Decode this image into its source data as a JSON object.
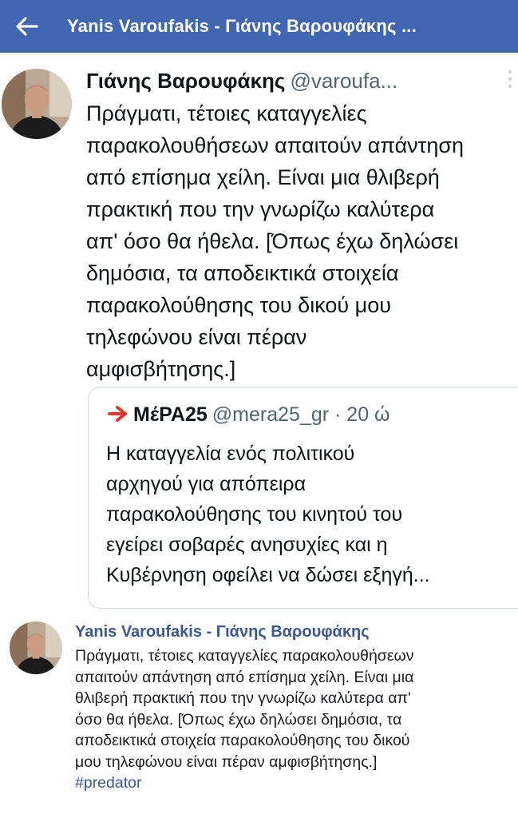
{
  "topbar": {
    "back_icon": "arrow-left-icon",
    "title": "Yanis Varoufakis - Γιάνης Βαρουφάκης ...",
    "bg_color": "#4267b2"
  },
  "tweet": {
    "name": "Γιάνης Βαρουφάκης",
    "handle": "@varoufa...",
    "lines": [
      "Πράγματι, τέτοιες καταγγελίες",
      "παρακολουθήσεων απαιτούν απάντηση",
      "από επίσημα χείλη. Είναι μια θλιβερή",
      "πρακτική που την γνωρίζω καλύτερα",
      "απ' όσο θα ήθελα. [Όπως έχω δηλώσει",
      "δημόσια, τα αποδεικτικά στοιχεία",
      "παρακολούθησης του δικού μου",
      "τηλεφώνου  είναι πέραν",
      "αμφισβήτησης.]"
    ],
    "quote": {
      "name": "ΜέΡΑ25",
      "meta": "@mera25_gr · 20 ώ",
      "lines": [
        "Η καταγγελία ενός πολιτικού",
        "αρχηγού για απόπειρα",
        "παρακολούθησης του κινητού του",
        "εγείρει σοβαρές ανησυχίες και η",
        "Κυβέρνηση οφείλει να δώσει εξηγή..."
      ]
    }
  },
  "post": {
    "author": "Yanis Varoufakis - Γιάνης Βαρουφάκης",
    "lines": [
      "Πράγματι, τέτοιες καταγγελίες παρακολουθήσεων",
      "απαιτούν απάντηση από επίσημα χείλη. Είναι μια",
      "θλιβερή πρακτική που την γνωρίζω καλύτερα απ'",
      "όσο θα ήθελα. [Όπως έχω δηλώσει δημόσια, τα",
      "αποδεικτικά στοιχεία παρακολούθησης του δικού",
      "μου τηλεφώνου είναι πέραν αμφισβήτησης.]"
    ],
    "hashtag": "#predator",
    "link_color": "#385898"
  }
}
